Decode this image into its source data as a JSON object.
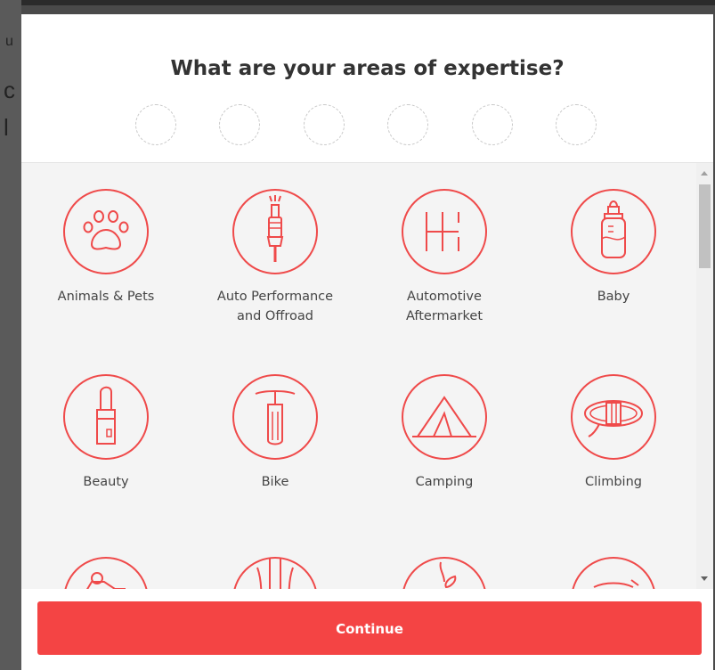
{
  "background": {
    "fragments": [
      "u",
      "c",
      "l"
    ]
  },
  "modal": {
    "title": "What are your areas of expertise?",
    "selection_slots": 6,
    "categories": [
      {
        "label_lines": [
          "Animals & Pets"
        ],
        "icon": "paw-icon"
      },
      {
        "label_lines": [
          "Auto Performance",
          "and Offroad"
        ],
        "icon": "spark-plug-icon"
      },
      {
        "label_lines": [
          "Automotive",
          "Aftermarket"
        ],
        "icon": "gear-shift-icon"
      },
      {
        "label_lines": [
          "Baby"
        ],
        "icon": "baby-bottle-icon"
      },
      {
        "label_lines": [
          "Beauty"
        ],
        "icon": "lipstick-icon"
      },
      {
        "label_lines": [
          "Bike"
        ],
        "icon": "bike-fork-icon"
      },
      {
        "label_lines": [
          "Camping"
        ],
        "icon": "tent-icon"
      },
      {
        "label_lines": [
          "Climbing"
        ],
        "icon": "rope-icon"
      }
    ],
    "continue_label": "Continue"
  },
  "colors": {
    "accent": "#f44444",
    "icon_stroke": "#ef4a4a",
    "grid_background": "#f4f4f4"
  }
}
